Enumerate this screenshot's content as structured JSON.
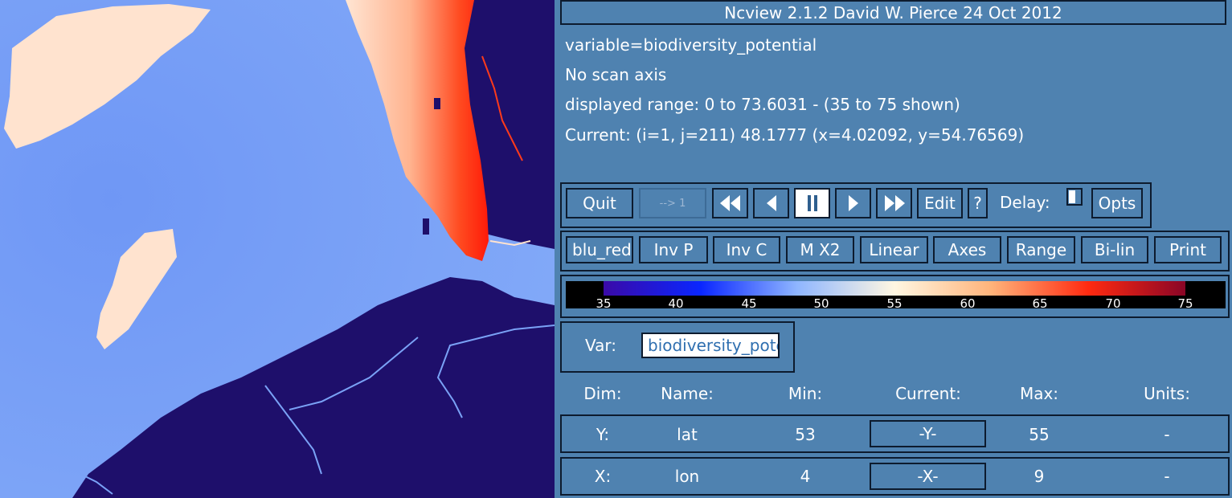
{
  "window": {
    "title": "Ncview 2.1.2 David W. Pierce  24 Oct 2012"
  },
  "info": {
    "variable": "variable=biodiversity_potential",
    "scan": "No scan axis",
    "range": "displayed range: 0 to 73.6031 - (35 to 75 shown)",
    "current": "Current: (i=1, j=211) 48.1777 (x=4.02092, y=54.76569)"
  },
  "controls": {
    "quit": "Quit",
    "to_first": "--> 1",
    "rewind_icon": "fast-rewind-icon",
    "back_icon": "step-back-icon",
    "pause_icon": "pause-icon",
    "forward_icon": "step-forward-icon",
    "ffwd_icon": "fast-forward-icon",
    "edit": "Edit",
    "help": "?",
    "delay_label": "Delay:",
    "opts": "Opts"
  },
  "options": {
    "colormap": "blu_red",
    "inv_p": "Inv P",
    "inv_c": "Inv C",
    "mag": "M X2",
    "transform": "Linear",
    "axes": "Axes",
    "range": "Range",
    "interp": "Bi-lin",
    "print": "Print"
  },
  "colorbar": {
    "ticks": [
      "35",
      "40",
      "45",
      "50",
      "55",
      "60",
      "65",
      "70",
      "75"
    ],
    "colors": [
      "#3a0aa8",
      "#0a26ff",
      "#8fb6ff",
      "#fff7e2",
      "#ffb37a",
      "#ff2a10",
      "#8a0526"
    ]
  },
  "var_selector": {
    "label": "Var:",
    "value": "biodiversity_potential"
  },
  "dims": {
    "headers": {
      "dim": "Dim:",
      "name": "Name:",
      "min": "Min:",
      "current": "Current:",
      "max": "Max:",
      "units": "Units:"
    },
    "rows": [
      {
        "dim": "Y:",
        "name": "lat",
        "min": "53",
        "current": "-Y-",
        "max": "55",
        "units": "-"
      },
      {
        "dim": "X:",
        "name": "lon",
        "min": "4",
        "current": "-X-",
        "max": "9",
        "units": "-"
      }
    ]
  },
  "map_colors": {
    "sea": "#7aa2f6",
    "land": "#1e0f6b",
    "high": "#ff2d0f",
    "mid": "#ffe3cf"
  }
}
